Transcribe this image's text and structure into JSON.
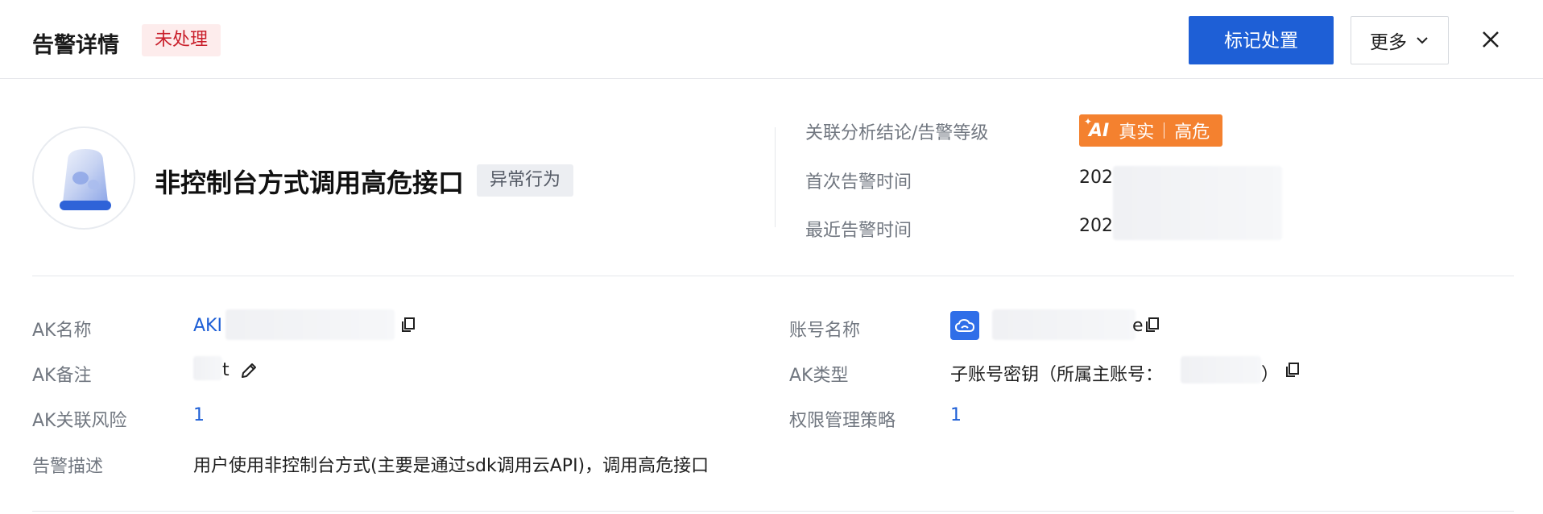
{
  "header": {
    "title": "告警详情",
    "status": "未处理",
    "mark_button": "标记处置",
    "more_button": "更多"
  },
  "summary": {
    "alert_name": "非控制台方式调用高危接口",
    "category_tag": "异常行为",
    "labels": {
      "conclusion": "关联分析结论/告警等级",
      "first_time": "首次告警时间",
      "last_time": "最近告警时间"
    },
    "ai_badge": {
      "ai_text": "AI",
      "verdict": "真实",
      "level": "高危"
    },
    "first_time_value": "202",
    "last_time_value": "202"
  },
  "details": {
    "ak_name_label": "AK名称",
    "ak_name_value": "AKI",
    "ak_remark_label": "AK备注",
    "ak_remark_value": "t",
    "ak_risk_label": "AK关联风险",
    "ak_risk_value": "1",
    "alert_desc_label": "告警描述",
    "alert_desc_value": "用户使用非控制台方式(主要是通过sdk调用云API)，调用高危接口",
    "account_name_label": "账号名称",
    "account_name_value": "e",
    "ak_type_label": "AK类型",
    "ak_type_value": "子账号密钥（所属主账号：",
    "ak_type_close": "）",
    "policy_label": "权限管理策略",
    "policy_value": "1"
  },
  "colors": {
    "primary": "#1e5fd6",
    "danger_bg": "#fdecec",
    "danger_text": "#c91f2b",
    "ai_orange": "#f4812f"
  }
}
